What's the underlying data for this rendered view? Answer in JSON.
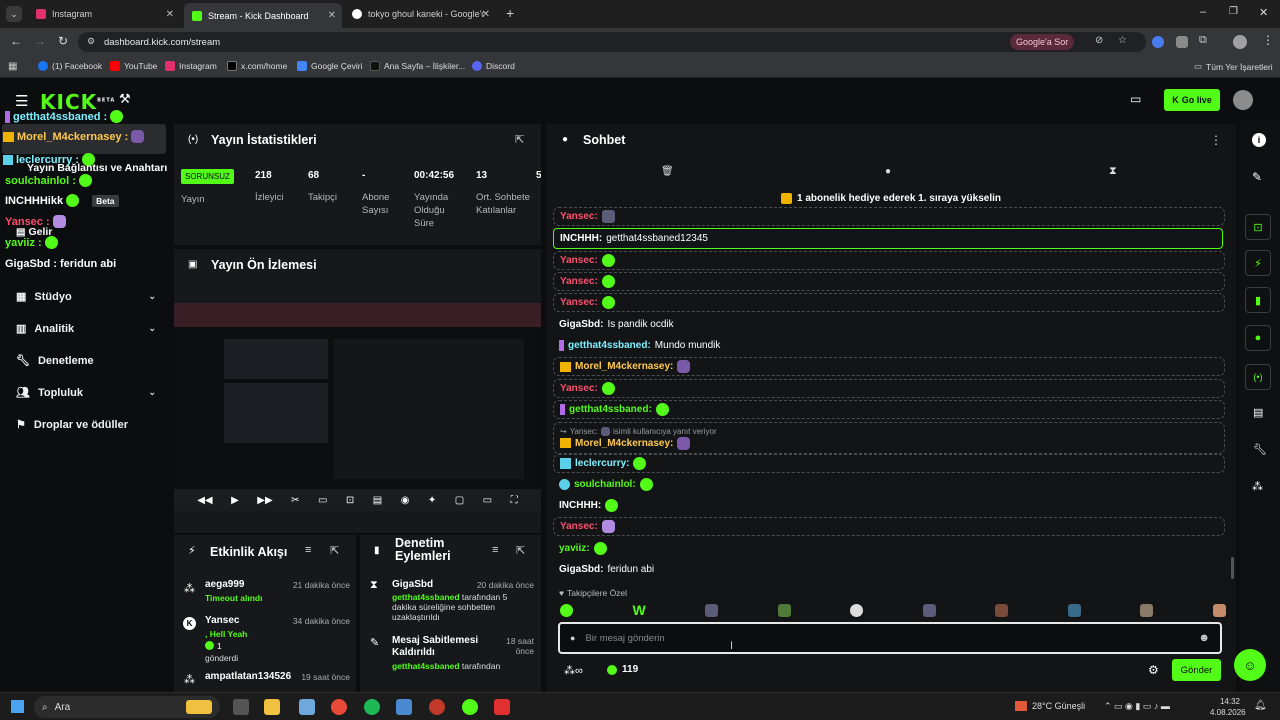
{
  "browser": {
    "tabs": [
      {
        "title": "Instagram"
      },
      {
        "title": "Stream - Kick Dashboard"
      },
      {
        "title": "tokyo ghoul kaneki - Google'da"
      }
    ],
    "url": "dashboard.kick.com/stream",
    "ask_google": "Google'a Sor",
    "bookmarks": [
      "(1) Facebook",
      "YouTube",
      "Instagram",
      "x.com/home",
      "Google Çeviri",
      "Ana Sayfa – İlişkiler...",
      "Discord"
    ],
    "all_bookmarks": "Tüm Yer İşaretleri"
  },
  "app": {
    "logo": "KICK",
    "logo_sup": "BETA",
    "go_live": "Go live"
  },
  "sidebar": {
    "overlay_labels": [
      "Yayın Bağlantısı ve Anahtarı",
      "Beta",
      "Gelir"
    ],
    "items": [
      {
        "label": "Stüdyo"
      },
      {
        "label": "Analitik"
      },
      {
        "label": "Denetleme"
      },
      {
        "label": "Topluluk"
      },
      {
        "label": "Droplar ve ödüller"
      }
    ],
    "overlay_chat": [
      {
        "user": "getthat4ssbaned :"
      },
      {
        "user": "Morel_M4ckernasey :"
      },
      {
        "user": "leclercurry :"
      },
      {
        "user": "soulchainlol :"
      },
      {
        "user": "INCHHHikk"
      },
      {
        "user": "Yansec :"
      },
      {
        "user": "yaviiz :"
      },
      {
        "user": "GigaSbd :",
        "text": "feridun abi"
      }
    ]
  },
  "stats": {
    "title": "Yayın İstatistikleri",
    "status_badge": "SORUNSUZ",
    "status_label": "Yayın",
    "items": [
      {
        "value": "218",
        "label": "İzleyici"
      },
      {
        "value": "68",
        "label": "Takipçi"
      },
      {
        "value": "-",
        "label": "Abone Sayısı"
      },
      {
        "value": "00:42:56",
        "label": "Yayında Olduğu Süre"
      },
      {
        "value": "13",
        "label": "Ort. Sohbete Katılanlar"
      },
      {
        "value": "5",
        "label": ""
      }
    ]
  },
  "preview": {
    "title": "Yayın Ön İzlemesi"
  },
  "activity": {
    "title": "Etkinlik Akışı",
    "events": [
      {
        "user": "aega999",
        "detail": "Timeout alındı",
        "time": "21 dakika önce"
      },
      {
        "user": "Yansec",
        "detail": ", Hell Yeah",
        "extra": "1",
        "extra2": "gönderdi",
        "time": "34 dakika önce"
      },
      {
        "user": "ampatlatan134526",
        "time": "19 saat önce"
      }
    ]
  },
  "moderation": {
    "title": "Denetim Eylemleri",
    "events": [
      {
        "title": "GigaSbd",
        "time": "20 dakika önce",
        "user": "getthat4ssbaned",
        "desc": "tarafından 5 dakika süreliğine sohbetten uzaklaştırıldı"
      },
      {
        "title": "Mesaj Sabitlemesi Kaldırıldı",
        "time": "18 saat önce",
        "user": "getthat4ssbaned",
        "desc": "tarafından"
      }
    ]
  },
  "chat": {
    "title": "Sohbet",
    "gift_banner": "1 abonelik hediye ederek 1. sıraya yükselin",
    "reply_hint": "Yansec:",
    "reply_suffix": "isimli kullanıcıya yanıt veriyor",
    "messages": [
      {
        "user": "Yansec:",
        "text": ""
      },
      {
        "user": "INCHHH:",
        "text": "getthat4ssbaned12345"
      },
      {
        "user": "Yansec:",
        "text": ""
      },
      {
        "user": "Yansec:",
        "text": ""
      },
      {
        "user": "Yansec:",
        "text": ""
      },
      {
        "user": "GigaSbd:",
        "text": "Is pandik ocdik"
      },
      {
        "user": "getthat4ssbaned:",
        "text": "Mundo mundik"
      },
      {
        "user": "Morel_M4ckernasey:",
        "text": ""
      },
      {
        "user": "Yansec:",
        "text": ""
      },
      {
        "user": "getthat4ssbaned:",
        "text": ""
      },
      {
        "user": "Morel_M4ckernasey:",
        "text": ""
      },
      {
        "user": "leclercurry:",
        "text": ""
      },
      {
        "user": "soulchainlol:",
        "text": ""
      },
      {
        "user": "INCHHH:",
        "text": ""
      },
      {
        "user": "Yansec:",
        "text": ""
      },
      {
        "user": "yaviiz:",
        "text": ""
      },
      {
        "user": "GigaSbd:",
        "text": "feridun abi"
      }
    ],
    "follower_only": "Takipçilere Özel",
    "input_placeholder": "Bir mesaj gönderin",
    "points": "119",
    "send": "Gönder"
  },
  "taskbar": {
    "search": "Ara",
    "weather": "28°C Güneşli",
    "time": "14:32",
    "date": "4.08.2026"
  },
  "colors": {
    "accent": "#53fc18",
    "panel": "#16181b",
    "bg": "#0b0d0f"
  }
}
